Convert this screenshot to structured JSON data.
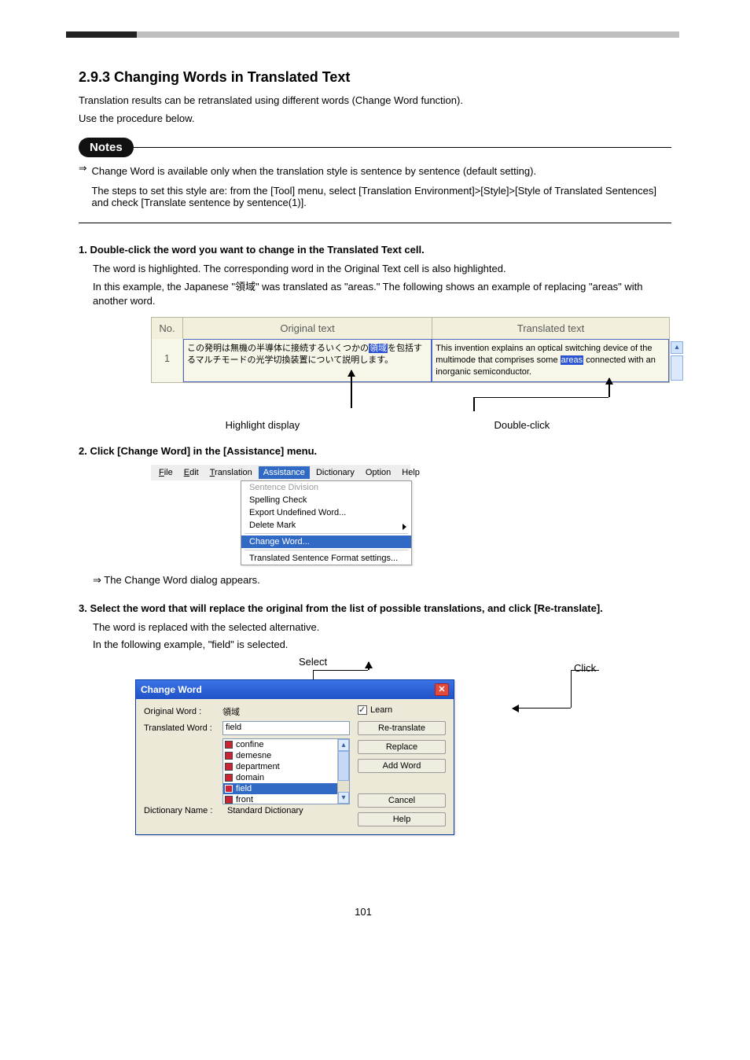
{
  "header": {
    "title": "2.9.3 Changing Words in Translated Text",
    "intro1": "Translation results can be retranslated using different words (Change Word function).",
    "intro2": "Use the procedure below."
  },
  "notes": {
    "label": "Notes",
    "arrow": "⇒",
    "line1": "Change Word is available only when the translation style is sentence by sentence (default setting).",
    "line2": "The steps to set this style are: from the [Tool] menu, select [Translation Environment]>[Style]>[Style of Translated Sentences] and check [Translate sentence by sentence(1)]."
  },
  "step1": {
    "num": "1. Double-click the word you want to change in the Translated Text cell.",
    "exp1": "The word is highlighted. The corresponding word in the Original Text cell is also highlighted.",
    "exp2": "In this example, the Japanese \"領域\" was translated as \"areas.\" The following shows an example of replacing \"areas\" with another word."
  },
  "table": {
    "h_no": "No.",
    "h_orig": "Original text",
    "h_trans": "Translated text",
    "row_no": "1",
    "orig_pre": "この発明は無機の半導体に接続するいくつかの",
    "orig_hl": "領域",
    "orig_post": "を包括するマルチモードの光学切換装置について説明します。",
    "trans_pre": "This invention explains an optical switching device of the multimode that comprises some ",
    "trans_hl": "areas",
    "trans_post": " connected with an inorganic semiconductor."
  },
  "tbl_cap": {
    "left": "Highlight display",
    "right": "Double-click"
  },
  "step2": {
    "num": "2. Click [Change Word] in the [Assistance] menu.",
    "note": "⇒ The Change Word dialog appears.",
    "menubar": {
      "file": "File",
      "edit": "Edit",
      "translation": "Translation",
      "assistance": "Assistance",
      "dictionary": "Dictionary",
      "option": "Option",
      "help": "Help"
    },
    "items": {
      "division": "Sentence Division",
      "spell": "Spelling Check",
      "export": "Export Undefined Word...",
      "delete": "Delete Mark",
      "change": "Change Word...",
      "format": "Translated Sentence Format settings..."
    }
  },
  "step3": {
    "num": "3. Select the word that will replace the original from the list of possible translations, and click [Re-translate].",
    "exp": "The word is replaced with the selected alternative.",
    "sub1": "In the following example, \"field\" is selected.",
    "cap_select": "Select",
    "cap_click": "Click"
  },
  "dialog": {
    "title": "Change Word",
    "orig_lbl": "Original Word :",
    "orig_val": "領域",
    "trans_lbl": "Translated Word :",
    "trans_val": "field",
    "list": [
      "confine",
      "demesne",
      "department",
      "domain",
      "field",
      "front"
    ],
    "dict_lbl": "Dictionary Name :",
    "dict_val": "Standard Dictionary",
    "learn": "Learn",
    "retranslate": "Re-translate",
    "replace": "Replace",
    "addword": "Add Word",
    "cancel": "Cancel",
    "help": "Help"
  },
  "page_number": "101"
}
